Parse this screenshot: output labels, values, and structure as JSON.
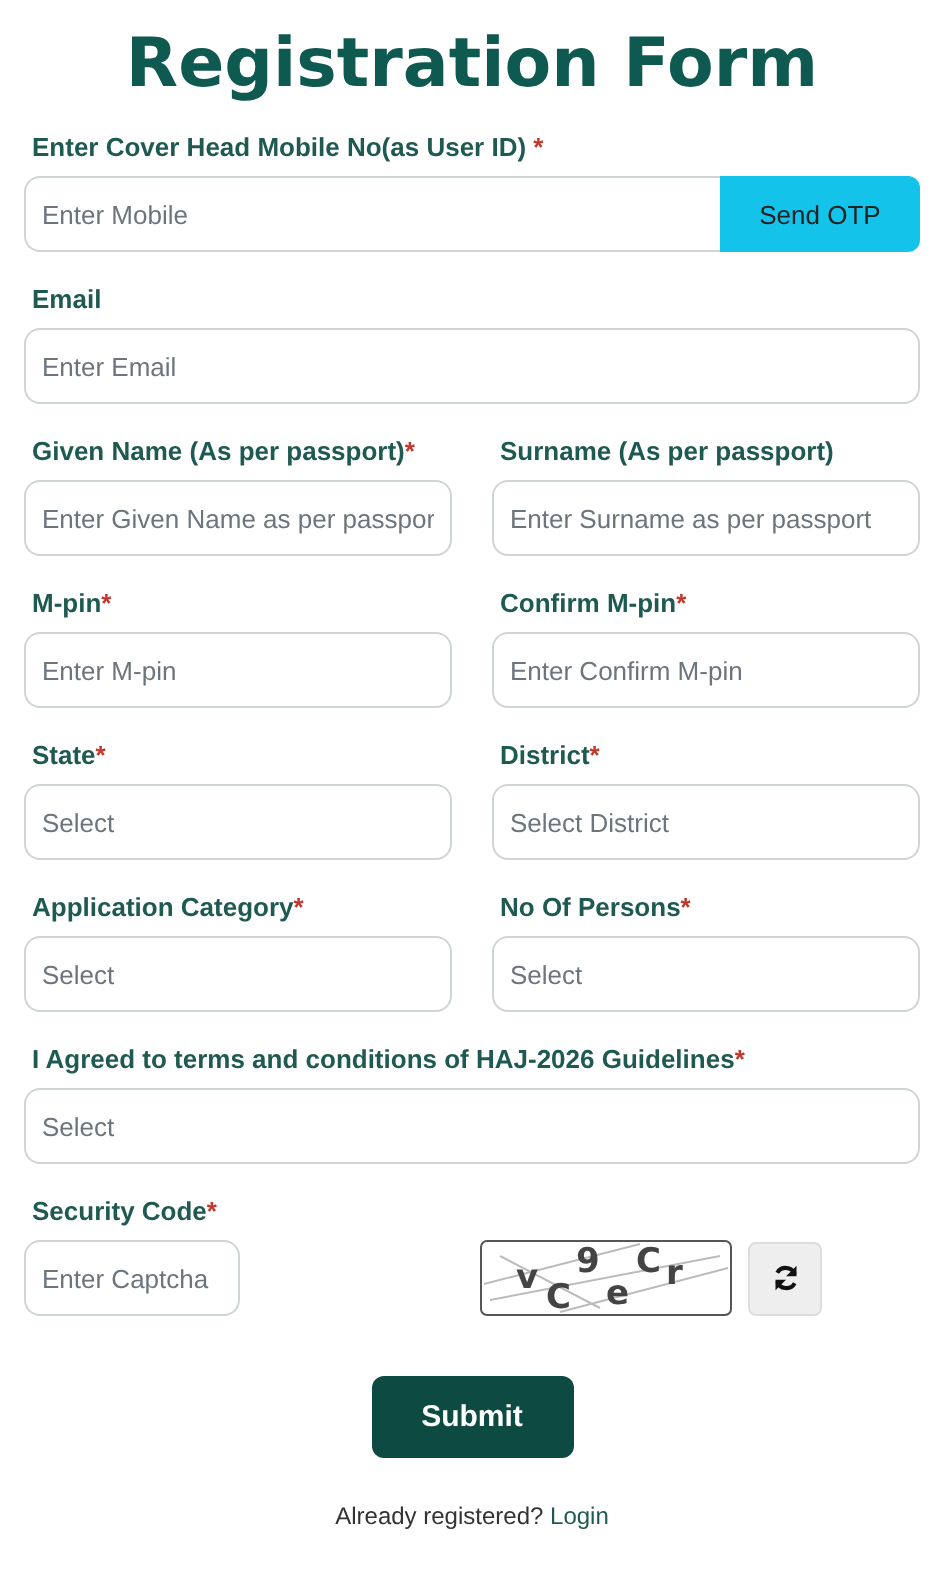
{
  "title": "Registration Form",
  "mobile": {
    "label": "Enter Cover Head Mobile No(as User ID)",
    "required_mark": "*",
    "placeholder": "Enter Mobile",
    "button": "Send OTP"
  },
  "rows": [
    [
      {
        "label": "Email",
        "placeholder": "Enter Email"
      }
    ],
    [
      {
        "label": "Given Name (As per passport)",
        "required_mark": "*",
        "placeholder": "Enter Given Name as per passpor"
      },
      {
        "label": "Surname (As per passport)",
        "placeholder": "Enter Surname as per passport"
      }
    ],
    [
      {
        "label": "M-pin",
        "required_mark": "*",
        "placeholder": "Enter M-pin"
      },
      {
        "label": "Confirm M-pin",
        "required_mark": "*",
        "placeholder": "Enter Confirm M-pin"
      }
    ],
    [
      {
        "label": "State",
        "required_mark": "*",
        "placeholder": "Select"
      },
      {
        "label": "District",
        "required_mark": "*",
        "placeholder": "Select District"
      }
    ],
    [
      {
        "label": "Application Category",
        "required_mark": "*",
        "placeholder": "Select"
      },
      {
        "label": "No Of Persons",
        "required_mark": "*",
        "placeholder": "Select"
      }
    ]
  ],
  "agreement": {
    "label": "I Agreed to terms and conditions of HAJ-2026 Guidelines",
    "required_mark": "*",
    "placeholder": "Select"
  },
  "security": {
    "label": "Security Code",
    "required_mark": "*",
    "placeholder": "Enter Captcha",
    "captcha": "vC9eCr"
  },
  "submit": "Submit",
  "footer": {
    "text": "Already registered?",
    "link": "Login"
  }
}
